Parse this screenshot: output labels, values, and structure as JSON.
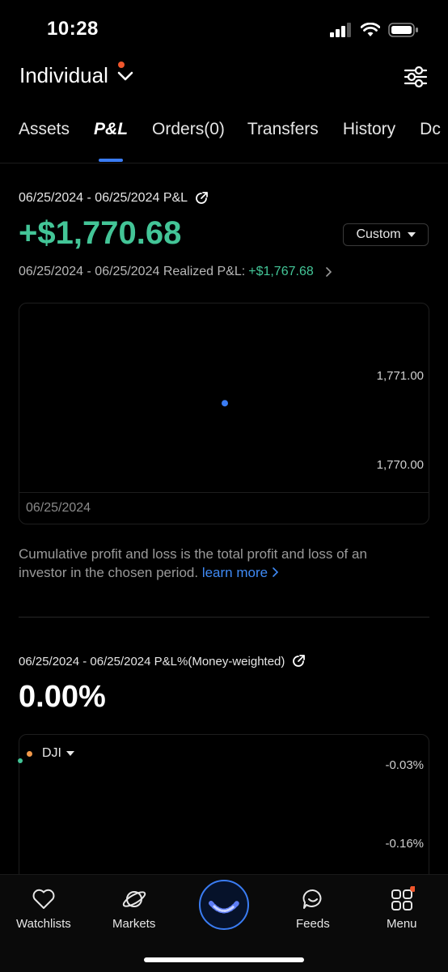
{
  "status_bar": {
    "time": "10:28"
  },
  "header": {
    "account_title": "Individual"
  },
  "tabs": [
    {
      "label": "Assets"
    },
    {
      "label": "P&L"
    },
    {
      "label": "Orders(0)"
    },
    {
      "label": "Transfers"
    },
    {
      "label": "History"
    },
    {
      "label": "Dc"
    }
  ],
  "pl": {
    "period_label": "06/25/2024 - 06/25/2024 P&L",
    "value": "+$1,770.68",
    "range_button": "Custom",
    "realized_label": "06/25/2024 - 06/25/2024 Realized P&L:",
    "realized_value": "+$1,767.68"
  },
  "chart_data": {
    "type": "scatter",
    "x": [
      "06/25/2024"
    ],
    "y": [
      1770.68
    ],
    "y_ticks": [
      "1,771.00",
      "1,770.00"
    ],
    "ylim": [
      1770.0,
      1771.0
    ],
    "x_tick_labels": [
      "06/25/2024"
    ],
    "point_color": "#3a7cf3"
  },
  "description": {
    "text": "Cumulative profit and loss is the total profit and loss of an investor in the chosen period.",
    "link": "learn more"
  },
  "money_weighted": {
    "period_label": "06/25/2024 - 06/25/2024 P&L%(Money-weighted)",
    "value": "0.00%",
    "benchmark": "DJI",
    "y_ticks": [
      "-0.03%",
      "-0.16%"
    ]
  },
  "bottom_nav": [
    {
      "label": "Watchlists",
      "icon": "heart-icon"
    },
    {
      "label": "Markets",
      "icon": "planet-icon"
    },
    {
      "label": "",
      "icon": "moomoo-logo"
    },
    {
      "label": "Feeds",
      "icon": "chat-smile-icon"
    },
    {
      "label": "Menu",
      "icon": "grid-icon"
    }
  ],
  "colors": {
    "accent": "#3a7cf3",
    "gain": "#43c597",
    "notification": "#f0562c"
  }
}
